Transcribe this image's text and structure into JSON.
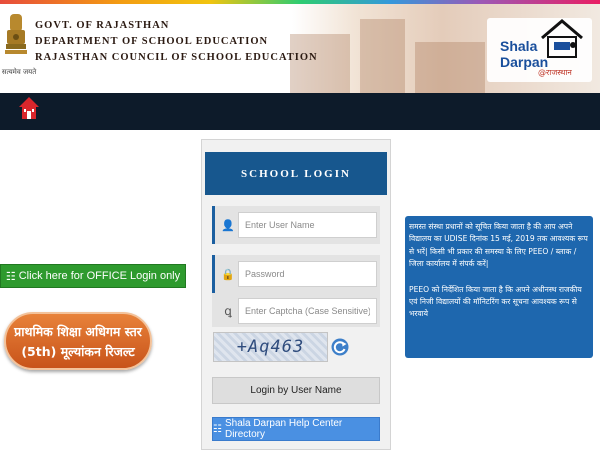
{
  "header": {
    "emblem_caption": "सत्यमेव जयते",
    "lines": [
      "GOVT. OF RAJASTHAN",
      "DEPARTMENT OF SCHOOL EDUCATION",
      "RAJASTHAN COUNCIL OF SCHOOL EDUCATION"
    ],
    "logo": {
      "shala": "Shala",
      "darpan": "Darpan",
      "sub": "@राजस्थान"
    }
  },
  "nav": {
    "home_icon": "home-icon"
  },
  "left": {
    "office_login": "Click here for OFFICE Login only",
    "result_line1": "प्राथमिक शिक्षा अधिगम स्तर",
    "result_line2": "(5th) मूल्यांकन रिजल्ट"
  },
  "login": {
    "title": "SCHOOL LOGIN",
    "username_placeholder": "Enter User Name",
    "password_placeholder": "Password",
    "captcha_placeholder": "Enter Captcha (Case Sensitive)",
    "captcha_text": "+Aq463",
    "login_button": "Login by User Name",
    "help_button": "Shala Darpan Help Center Directory"
  },
  "notice": {
    "para1": "समस्त संस्था प्रधानों को सूचित किया जाता है की आप अपने विद्यालय का UDISE दिनांक 15 मई, 2019 तक आवश्यक रूप से भरें| किसी भी प्रकार की समस्या के लिए PEEO / ब्लाक / जिला कार्यालय में संपर्क करें|",
    "para2": "PEEO को निर्देशित किया जाता है कि अपने अधीनस्थ राजकीय एवं निजी विद्यालयों की मॉनिटरिंग कर सूचना आवश्यक रूप से भरवाये"
  },
  "colors": {
    "navbar": "#0d1b2a",
    "title_bar": "#17578e",
    "notice": "#1e67ae",
    "office_btn": "#2e9a2e",
    "help_btn": "#4a90e2"
  }
}
